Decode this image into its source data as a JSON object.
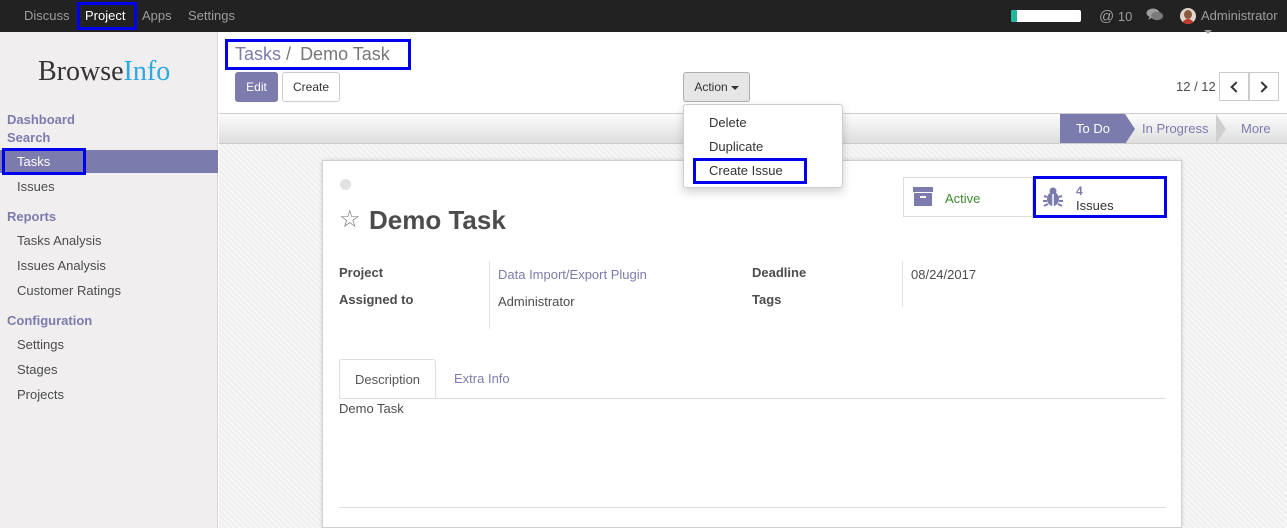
{
  "topbar": {
    "menus": [
      "Discuss",
      "Project",
      "Apps",
      "Settings"
    ],
    "active_menu": "Project",
    "progress_percent": 8,
    "mentions_count": "10",
    "user_name": "Administrator"
  },
  "logo": {
    "part1": "Browse",
    "part2": "Info"
  },
  "sidebar": {
    "sections": [
      {
        "title": "Dashboard"
      },
      {
        "title": "Search",
        "items": [
          "Tasks",
          "Issues"
        ]
      },
      {
        "title": "Reports",
        "items": [
          "Tasks Analysis",
          "Issues Analysis",
          "Customer Ratings"
        ]
      },
      {
        "title": "Configuration",
        "items": [
          "Settings",
          "Stages",
          "Projects"
        ]
      }
    ],
    "active_item": "Tasks"
  },
  "breadcrumb": {
    "parent": "Tasks",
    "separator": "/",
    "current": "Demo Task"
  },
  "buttons": {
    "edit": "Edit",
    "create": "Create",
    "action": "Action"
  },
  "pager": {
    "value": "12 / 12"
  },
  "action_menu": {
    "items": [
      "Delete",
      "Duplicate",
      "Create Issue"
    ]
  },
  "stages": {
    "items": [
      "To Do",
      "In Progress",
      "More"
    ],
    "current": "To Do"
  },
  "record": {
    "title": "Demo Task",
    "active_label": "Active",
    "issues_count": "4",
    "issues_label": "Issues",
    "fields": {
      "project_label": "Project",
      "project_value": "Data Import/Export Plugin",
      "assigned_label": "Assigned to",
      "assigned_value": "Administrator",
      "deadline_label": "Deadline",
      "deadline_value": "08/24/2017",
      "tags_label": "Tags"
    },
    "tabs": [
      "Description",
      "Extra Info"
    ],
    "description": "Demo Task"
  },
  "colors": {
    "brand": "#7c7bad",
    "topbar": "#222222",
    "highlight": "#0000ee"
  }
}
